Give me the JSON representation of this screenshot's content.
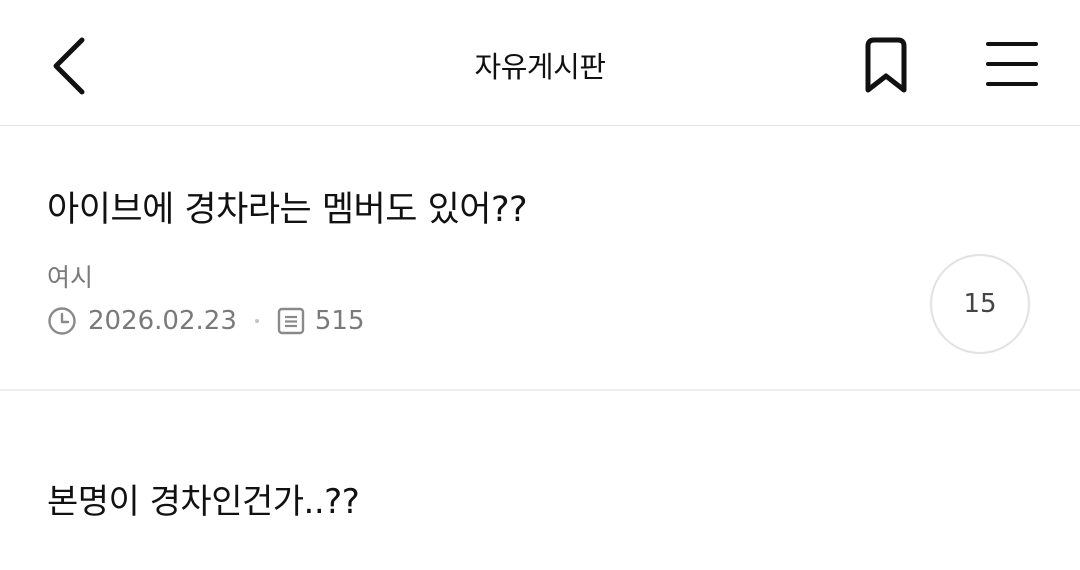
{
  "header": {
    "title": "자유게시판",
    "back_icon": "chevron-left-icon",
    "bookmark_icon": "bookmark-icon",
    "menu_icon": "hamburger-menu-icon"
  },
  "post": {
    "title": "아이브에 경차라는 멤버도 있어??",
    "author": "여시",
    "date": "2026.02.23",
    "views": "515",
    "comment_count": "15",
    "body": "본명이 경차인건가..??"
  },
  "colors": {
    "text": "#111111",
    "muted": "#7a7a7a",
    "divider": "#e6e6e6"
  }
}
